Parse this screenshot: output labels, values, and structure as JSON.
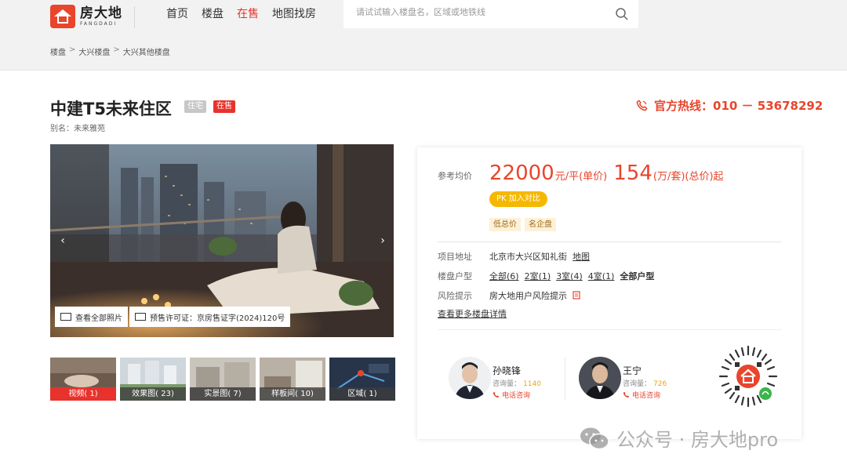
{
  "header": {
    "logo": {
      "name_cn": "房大地",
      "name_en": "FANGDADI"
    },
    "nav": [
      {
        "label": "首页",
        "active": false
      },
      {
        "label": "楼盘",
        "active": false
      },
      {
        "label": "在售",
        "active": true
      },
      {
        "label": "地图找房",
        "active": false
      }
    ],
    "search": {
      "placeholder": "请试试输入楼盘名，区域或地铁线",
      "value": ""
    }
  },
  "breadcrumb": [
    "楼盘",
    "大兴楼盘",
    "大兴其他楼盘"
  ],
  "breadcrumb_sep": ">",
  "project": {
    "title": "中建T5未来住区",
    "type_tag": "住宅",
    "status_tag": "在售",
    "alias": "别名：未来雅苑",
    "hotline": "官方热线：010 － 53678292"
  },
  "gallery": {
    "all_photos_label": "查看全部照片",
    "permit_label": "预售许可证：京房售证字(2024)120号",
    "prev": "‹",
    "next": "›",
    "thumbs": [
      {
        "label": "视频( 1)",
        "active": true
      },
      {
        "label": "效果图( 23)",
        "active": false
      },
      {
        "label": "实景图( 7)",
        "active": false
      },
      {
        "label": "样板间( 10)",
        "active": false
      },
      {
        "label": "区域( 1)",
        "active": false
      }
    ]
  },
  "info": {
    "price_label": "参考均价",
    "unit_price": "22000",
    "unit_price_suffix": "元/平(单价)",
    "total_price": "154",
    "total_price_suffix": "(万/套)(总价)起",
    "pk_label": "PK 加入对比",
    "features": [
      "低总价",
      "名企盘"
    ],
    "address_label": "项目地址",
    "address": "北京市大兴区知礼街",
    "map_link": "地图",
    "layout_label": "楼盘户型",
    "layouts": [
      "全部(6)",
      "2室(1)",
      "3室(4)",
      "4室(1)",
      "全部户型"
    ],
    "risk_label": "风险提示",
    "risk_text": "房大地用户风险提示",
    "more_link": "查看更多楼盘详情"
  },
  "agents": [
    {
      "name": "孙晓锋",
      "inquiry_label": "咨询量：",
      "inquiries": "1140",
      "call_label": "电话咨询"
    },
    {
      "name": "王宁",
      "inquiry_label": "咨询量：",
      "inquiries": "726",
      "call_label": "电话咨询"
    }
  ],
  "watermark": "公众号 · 房大地pro",
  "colors": {
    "brand_red": "#e8452c",
    "active_red": "#e8322c",
    "pk_yellow": "#f5b800",
    "tag_bg": "#fdf1d9"
  }
}
